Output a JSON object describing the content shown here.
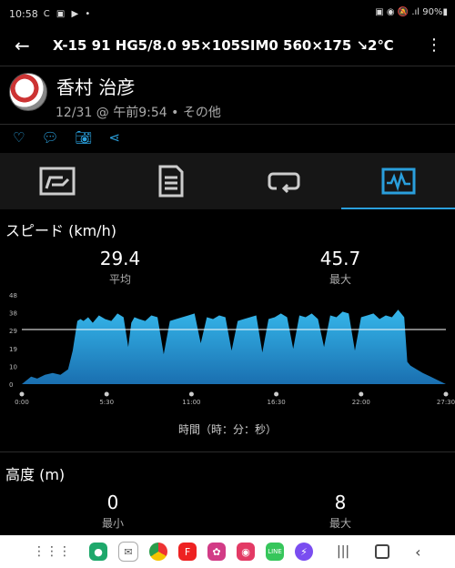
{
  "status": {
    "time": "10:58",
    "icons": "C ▣ ▶ •",
    "right": "▣ ◉ 🔕 .ıl 90%▮"
  },
  "appbar": {
    "title": "X-15 91 HG5/8.0 95×105SIM0 560×175 ↘2℃"
  },
  "user": {
    "name": "香村 治彦",
    "when": "12/31 @ 午前9:54 • その他"
  },
  "actions": [
    "heart-icon",
    "comment-icon",
    "camera-icon",
    "share-icon"
  ],
  "tabs": [
    "summary-icon",
    "details-icon",
    "laps-icon",
    "chart-icon"
  ],
  "speed": {
    "title": "スピード (km/h)",
    "avg": "29.4",
    "avg_label": "平均",
    "max": "45.7",
    "max_label": "最大",
    "xaxis_title": "時間（時：分：秒）"
  },
  "elevation": {
    "title": "高度 (m)",
    "min": "0",
    "min_label": "最小",
    "max": "8",
    "max_label": "最大"
  },
  "chart_data": {
    "type": "area",
    "yticks": [
      "0",
      "10",
      "19",
      "29",
      "38",
      "48"
    ],
    "xticks": [
      "0:00",
      "5:30",
      "11:00",
      "16:30",
      "22:00",
      "27:30"
    ],
    "ylim": [
      0,
      48
    ],
    "avg_line": 29.4,
    "x": [
      0,
      0.3,
      0.6,
      1.0,
      1.5,
      2.0,
      2.5,
      3.0,
      3.3,
      3.6,
      3.8,
      4.0,
      4.3,
      4.6,
      5.0,
      5.4,
      5.8,
      6.2,
      6.6,
      6.9,
      7.1,
      7.3,
      7.6,
      8.0,
      8.4,
      8.8,
      9.2,
      9.6,
      10.0,
      10.4,
      10.8,
      11.2,
      11.6,
      12.0,
      12.4,
      12.8,
      13.2,
      13.6,
      14.0,
      14.4,
      14.8,
      15.2,
      15.6,
      16.0,
      16.4,
      16.8,
      17.2,
      17.6,
      18.0,
      18.4,
      18.8,
      19.2,
      19.6,
      20.0,
      20.4,
      20.8,
      21.2,
      21.6,
      22.0,
      22.4,
      22.8,
      23.2,
      23.6,
      24.0,
      24.4,
      24.8,
      25.0,
      25.2,
      25.6,
      26.0,
      26.5,
      27.0,
      27.5
    ],
    "values": [
      0,
      2,
      4,
      3,
      5,
      6,
      5,
      8,
      18,
      34,
      35,
      34,
      36,
      33,
      37,
      35,
      34,
      38,
      36,
      20,
      33,
      36,
      35,
      34,
      37,
      36,
      16,
      34,
      35,
      36,
      37,
      38,
      22,
      36,
      35,
      37,
      36,
      18,
      34,
      35,
      36,
      37,
      17,
      35,
      36,
      38,
      36,
      19,
      37,
      36,
      38,
      35,
      20,
      37,
      36,
      39,
      38,
      18,
      36,
      37,
      38,
      35,
      37,
      36,
      40,
      36,
      12,
      10,
      8,
      6,
      4,
      2,
      0
    ]
  }
}
